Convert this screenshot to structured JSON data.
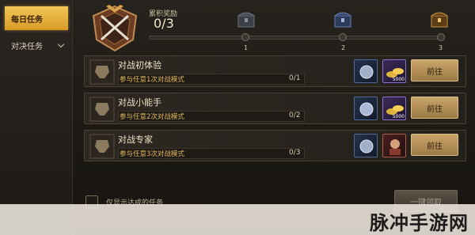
{
  "sidebar": {
    "tabs": [
      {
        "label": "每日任务",
        "active": true
      },
      {
        "label": "对决任务",
        "active": false
      }
    ]
  },
  "header": {
    "reward_title": "累积奖励",
    "reward_count": "0/3",
    "nodes": [
      "1",
      "2",
      "3"
    ]
  },
  "tasks": [
    {
      "title": "对战初体验",
      "desc": "参与任意1次对战模式",
      "progress": "0/1",
      "reward_a": "",
      "reward_b": "5000",
      "button": "前往"
    },
    {
      "title": "对战小能手",
      "desc": "参与任意2次对战模式",
      "progress": "0/2",
      "reward_a": "",
      "reward_b": "5000",
      "button": "前往"
    },
    {
      "title": "对战专家",
      "desc": "参与任意3次对战模式",
      "progress": "0/3",
      "reward_a": "",
      "reward_b": "",
      "button": "前往"
    }
  ],
  "footer": {
    "checkbox_label": "仅显示达成的任务",
    "claim_all": "一键领取"
  },
  "watermark": "脉冲手游网",
  "colors": {
    "accent_gold": "#d99b26",
    "desc_gold": "#e4b75a",
    "button": "#c9a56a"
  }
}
